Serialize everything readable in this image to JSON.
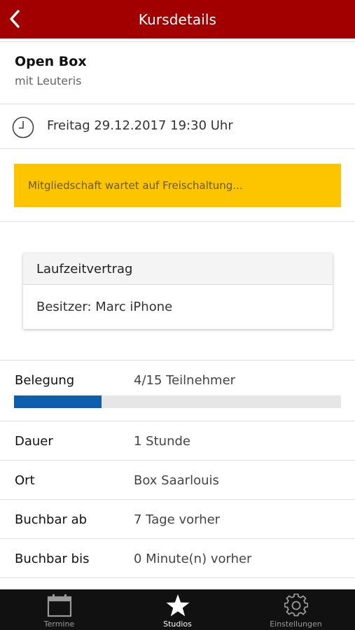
{
  "header": {
    "title": "Kursdetails",
    "back_icon": "chevron-left-icon"
  },
  "course": {
    "name": "Open Box",
    "trainer": "mit Leuteris"
  },
  "schedule": {
    "icon": "clock-icon",
    "datetime": "Freitag 29.12.2017 19:30 Uhr"
  },
  "membership_notice": {
    "text": "Mitgliedschaft wartet auf Freischaltung...",
    "color": "#fdc500"
  },
  "contract": {
    "title": "Laufzeitvertrag",
    "owner": "Besitzer: Marc iPhone"
  },
  "details": {
    "occupancy": {
      "label": "Belegung",
      "value": "4/15 Teilnehmer",
      "fraction": 0.2667,
      "bar_color": "#0d5fad"
    },
    "rows": [
      {
        "label": "Dauer",
        "value": "1 Stunde"
      },
      {
        "label": "Ort",
        "value": "Box Saarlouis"
      },
      {
        "label": "Buchbar ab",
        "value": "7 Tage vorher"
      },
      {
        "label": "Buchbar bis",
        "value": "0 Minute(n) vorher"
      }
    ]
  },
  "tabbar": {
    "tabs": [
      {
        "label": "Termine",
        "icon": "calendar-icon",
        "active": false
      },
      {
        "label": "Studios",
        "icon": "star-icon",
        "active": true
      },
      {
        "label": "Einstellungen",
        "icon": "gear-icon",
        "active": false
      }
    ]
  },
  "colors": {
    "brand": "#a20000",
    "tabbar": "#111111"
  }
}
